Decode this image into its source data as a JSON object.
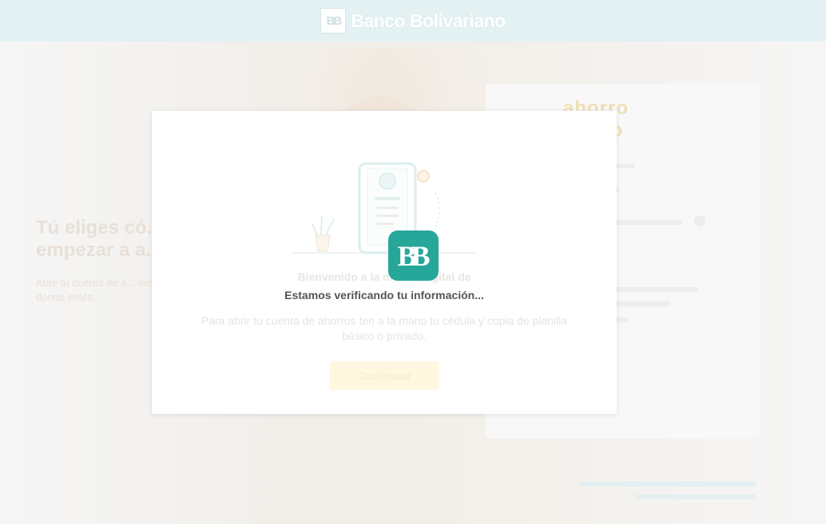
{
  "header": {
    "brand_mark": "BB",
    "brand_name": "Banco Bolivariano"
  },
  "background": {
    "hero_title": "Tú eliges có... empezar a a...",
    "hero_subtitle": "Abre tu cuenta de a... desde donde estés.",
    "card_logo": "ahorro futuro"
  },
  "modal": {
    "welcome_text": "Bienvenido a la oficina digital de",
    "status_text": "Estamos verificando tu información...",
    "description": "Para abrir tu cuenta de ahorros ten a la mano tu cédula y copia de planilla básico o privado.",
    "confirm_label": "Continuar",
    "loader_mark": "BB"
  },
  "colors": {
    "header_bg": "#e3f1f3",
    "brand_teal": "#27a79a",
    "confirm_bg": "#fff7e0"
  }
}
